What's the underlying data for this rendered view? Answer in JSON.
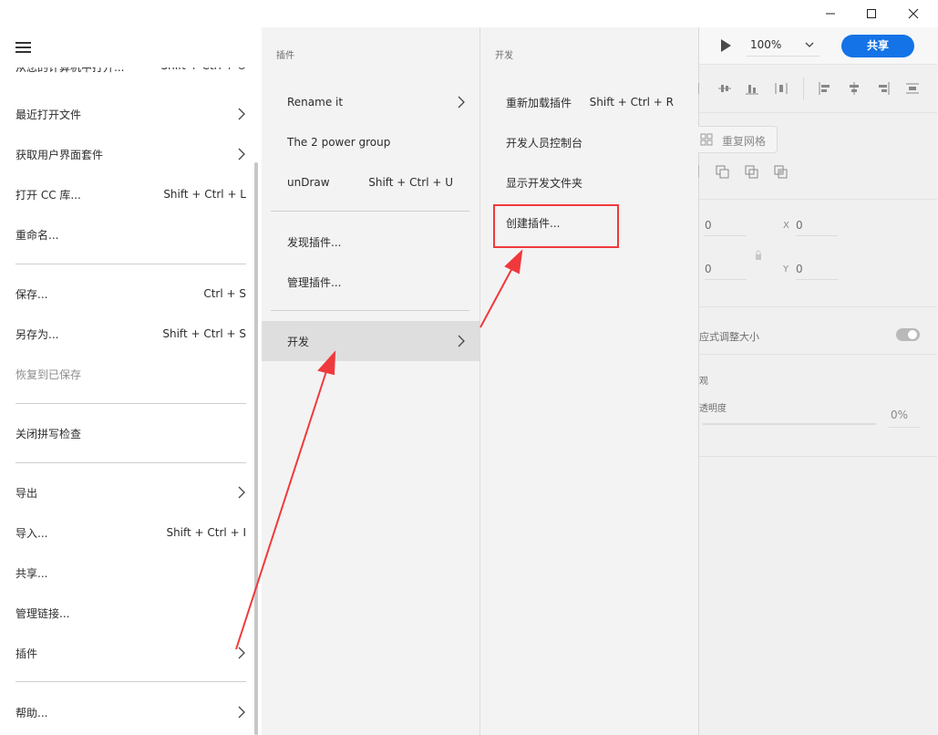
{
  "window": {
    "controls": [
      "minimize",
      "maximize",
      "close"
    ]
  },
  "toolbar": {
    "zoom": "100%",
    "share_label": "共享"
  },
  "properties": {
    "repeat_grid_label": "重复网格",
    "w_value": "0",
    "h_value": "0",
    "x_label": "X",
    "x_value": "0",
    "y_label": "Y",
    "y_value": "0",
    "responsive_label": "应式调整大小",
    "appearance_label": "观",
    "opacity_label": "透明度",
    "opacity_value": "0%"
  },
  "menu1": {
    "cut_item": {
      "label": "从您的计算机中打开...",
      "shortcut": "Shift + Ctrl + O"
    },
    "items": [
      {
        "label": "最近打开文件",
        "shortcut": ""
      },
      {
        "label": "获取用户界面套件",
        "shortcut": ""
      },
      {
        "label": "打开 CC 库...",
        "shortcut": "Shift + Ctrl + L"
      },
      {
        "label": "重命名...",
        "shortcut": ""
      },
      {
        "label": "保存...",
        "shortcut": "Ctrl + S"
      },
      {
        "label": "另存为...",
        "shortcut": "Shift + Ctrl + S"
      },
      {
        "label": "恢复到已保存",
        "shortcut": ""
      },
      {
        "label": "关闭拼写检查",
        "shortcut": ""
      },
      {
        "label": "导出",
        "shortcut": ""
      },
      {
        "label": "导入...",
        "shortcut": "Shift + Ctrl + I"
      },
      {
        "label": "共享...",
        "shortcut": ""
      },
      {
        "label": "管理链接...",
        "shortcut": ""
      },
      {
        "label": "插件",
        "shortcut": ""
      },
      {
        "label": "帮助...",
        "shortcut": ""
      }
    ]
  },
  "menu2": {
    "title": "插件",
    "items": [
      {
        "label": "Rename it",
        "shortcut": ""
      },
      {
        "label": "The 2 power group",
        "shortcut": ""
      },
      {
        "label": "unDraw",
        "shortcut": "Shift + Ctrl + U"
      },
      {
        "label": "发现插件...",
        "shortcut": ""
      },
      {
        "label": "管理插件...",
        "shortcut": ""
      },
      {
        "label": "开发",
        "shortcut": ""
      }
    ]
  },
  "menu3": {
    "title": "开发",
    "items": [
      {
        "label": "重新加载插件",
        "shortcut": "Shift + Ctrl + R"
      },
      {
        "label": "开发人员控制台",
        "shortcut": ""
      },
      {
        "label": "显示开发文件夹",
        "shortcut": ""
      },
      {
        "label": "创建插件...",
        "shortcut": ""
      }
    ]
  },
  "colors": {
    "accent": "#1473e6",
    "annotation": "#f0393c"
  }
}
